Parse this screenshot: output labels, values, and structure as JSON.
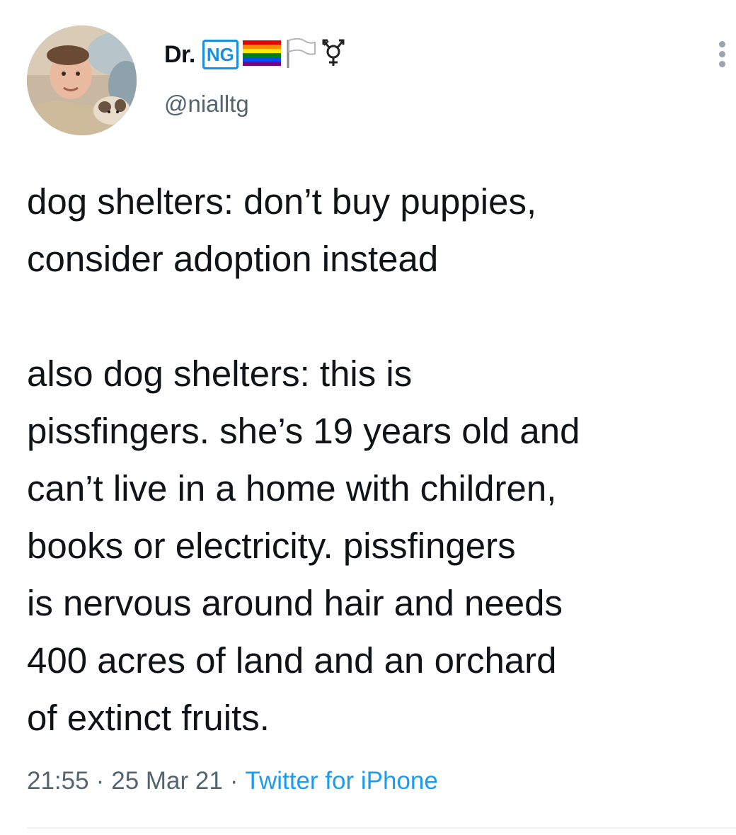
{
  "author": {
    "display_name": "Dr.",
    "badge": "NG",
    "emoji_icons": [
      "rainbow-flag-icon",
      "white-flag-icon",
      "transgender-symbol-icon"
    ],
    "handle": "@nialltg"
  },
  "tweet": {
    "paragraphs": [
      "dog shelters: don’t buy puppies,\nconsider adoption instead",
      "also dog shelters: this is\npissfingers. she’s 19 years old and\ncan’t live in a home with children,\nbooks or electricity. pissfingers\nis nervous around hair and needs\n400 acres of land and an orchard\nof extinct fruits."
    ]
  },
  "meta": {
    "time": "21:55",
    "separator": "·",
    "date": "25 Mar 21",
    "source": "Twitter for iPhone"
  },
  "colors": {
    "text": "#0f1419",
    "secondary": "#536471",
    "link": "#1d9bf0",
    "badge": "#1d8fe0"
  }
}
